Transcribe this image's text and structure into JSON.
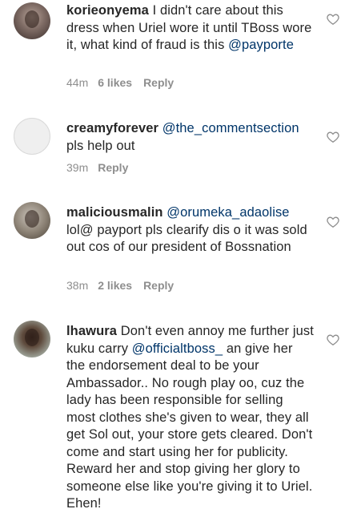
{
  "comments": [
    {
      "username": "korieonyema",
      "parts": [
        {
          "text": "I didn't care about this dress when Uriel wore it until TBoss wore it, what kind of fraud is this ",
          "mention": false
        },
        {
          "text": "@payporte",
          "mention": true
        }
      ],
      "time": "44m",
      "likes": "6 likes",
      "reply": "Reply",
      "avatar": "photo"
    },
    {
      "username": "creamyforever",
      "parts": [
        {
          "text": "@the_commentsection",
          "mention": true
        },
        {
          "text": " pls help out",
          "mention": false
        }
      ],
      "time": "39m",
      "likes": "",
      "reply": "Reply",
      "avatar": "empty"
    },
    {
      "username": "maliciousmalin",
      "parts": [
        {
          "text": "@orumeka_adaolise",
          "mention": true
        },
        {
          "text": " lol@ payport pls clearify dis o it was sold out cos of our president of Bossnation",
          "mention": false
        }
      ],
      "time": "38m",
      "likes": "2 likes",
      "reply": "Reply",
      "avatar": "photo"
    },
    {
      "username": "lhawura",
      "parts": [
        {
          "text": "Don't even annoy me further just kuku carry ",
          "mention": false
        },
        {
          "text": "@officialtboss_",
          "mention": true
        },
        {
          "text": " an give her the endorsement deal to be your Ambassador.. No rough play oo, cuz the lady has been responsible for selling most clothes she's given to wear, they all get Sol out, your store gets cleared. Don't come and start using her for publicity. Reward her and stop giving her glory to someone else like you're giving it to Uriel. Ehen!",
          "mention": false
        }
      ],
      "time": "",
      "likes": "",
      "reply": "",
      "avatar": "photo"
    }
  ],
  "icons": {
    "like": "heart-outline-icon"
  },
  "colors": {
    "text": "#262626",
    "mention": "#003569",
    "meta": "#8e8e8e",
    "background": "#ffffff"
  }
}
